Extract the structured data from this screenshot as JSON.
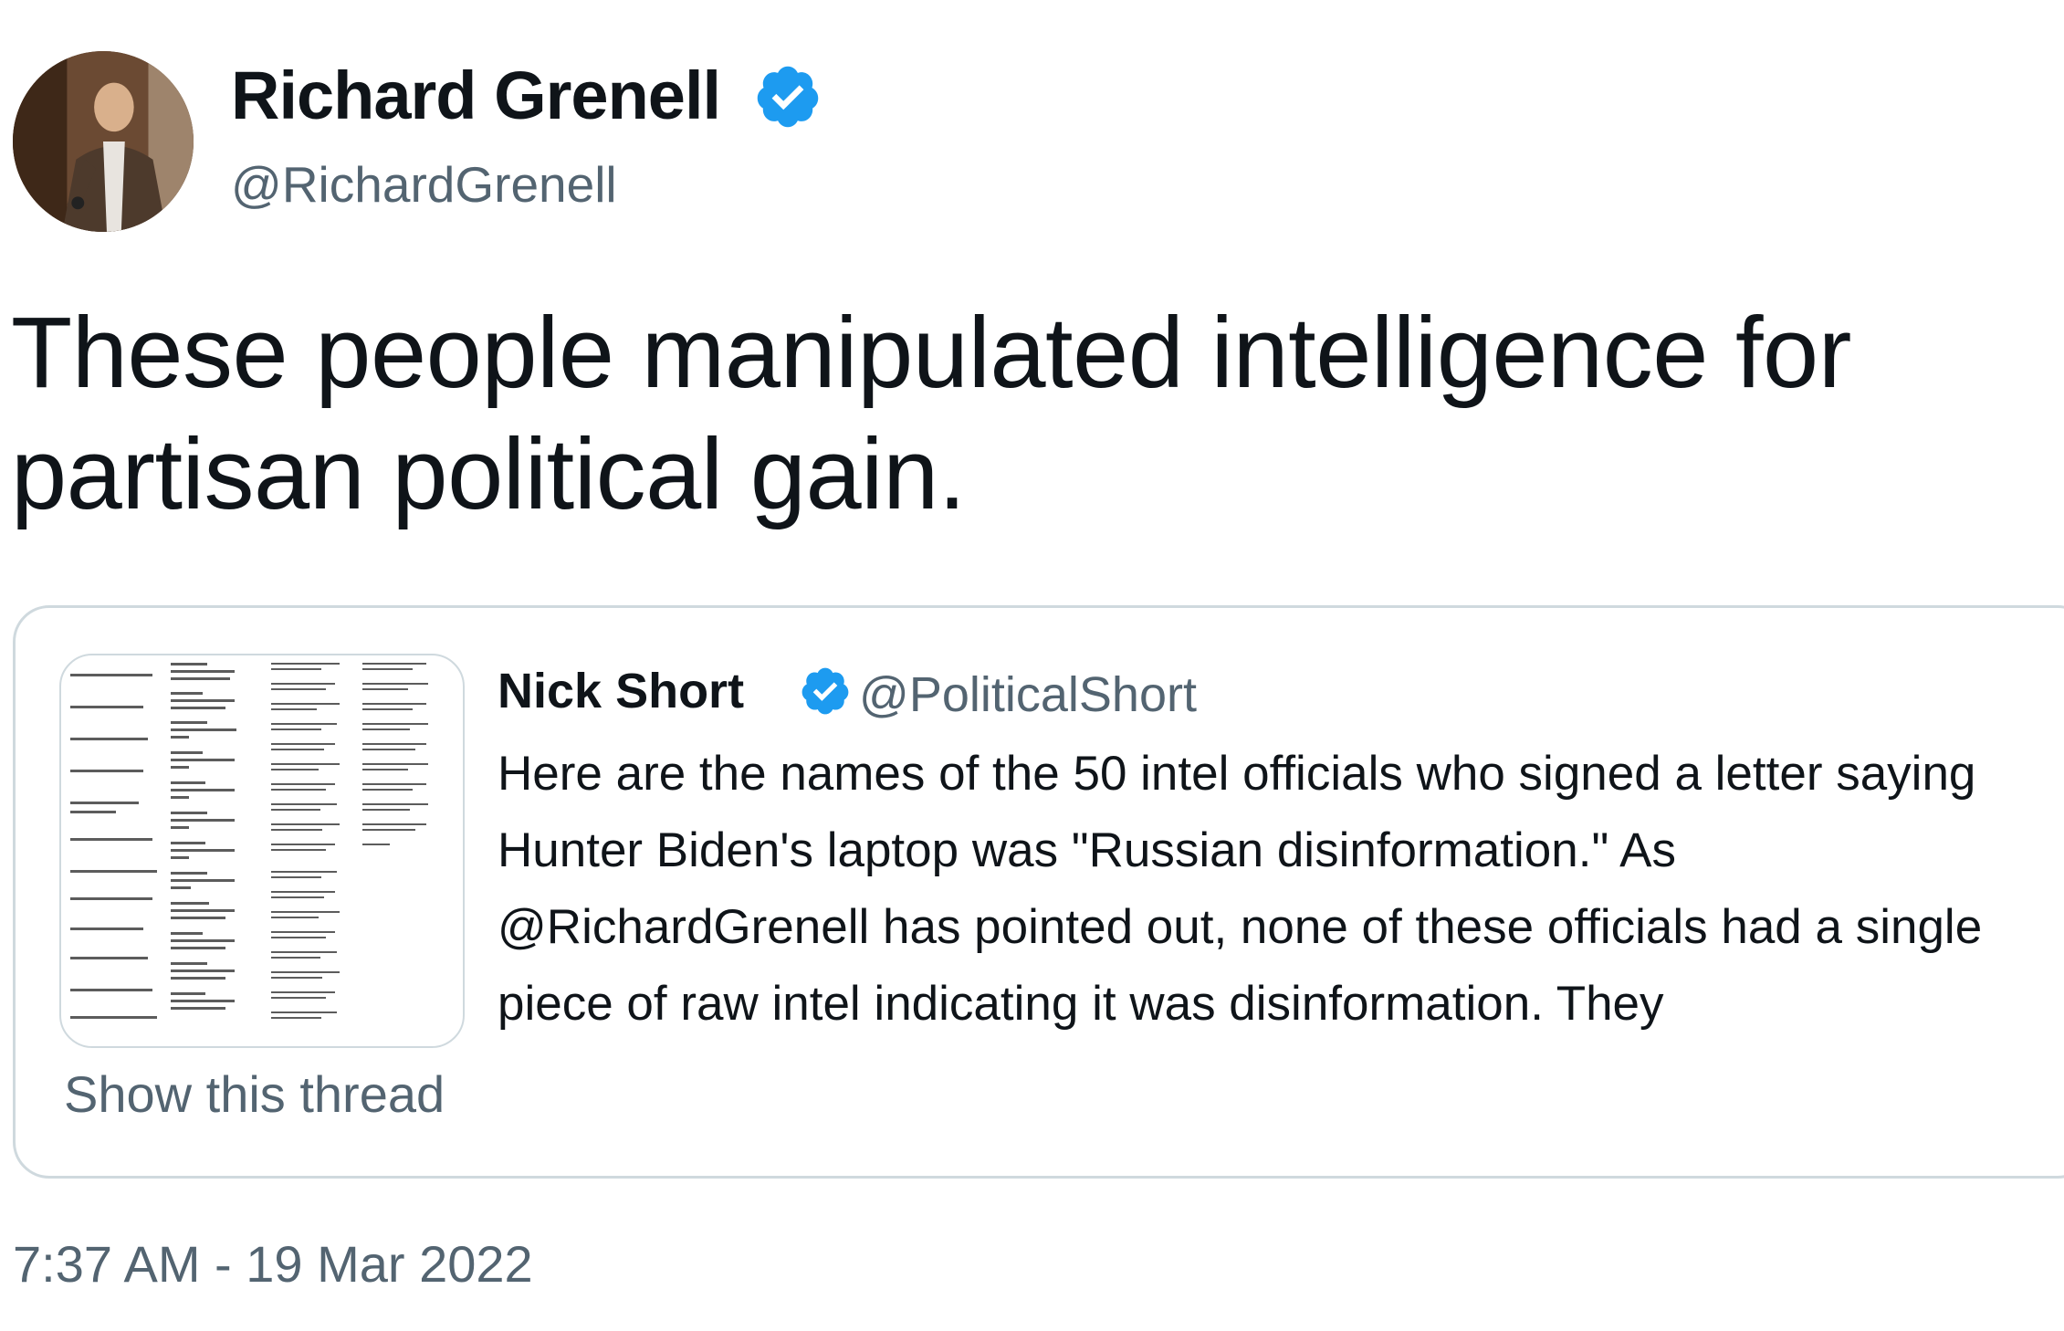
{
  "tweet": {
    "display_name": "Richard Grenell",
    "handle": "@RichardGrenell",
    "text": "These people manipulated intelligence for partisan political gain.",
    "timestamp": "7:37 AM - 19 Mar 2022",
    "verified_color": "#1d9bf0",
    "icons": {
      "verified": "verified-badge-icon",
      "avatar": "avatar-photo"
    }
  },
  "quote": {
    "display_name": "Nick Short",
    "handle": "@PoliticalShort",
    "text": "Here are the names of the 50 intel officials who signed a letter saying Hunter Biden's laptop was \"Russian disinformation.\" As @RichardGrenell has pointed out, none of these officials had a single piece of raw intel indicating it was disinformation. They",
    "show_thread": "Show this thread"
  }
}
